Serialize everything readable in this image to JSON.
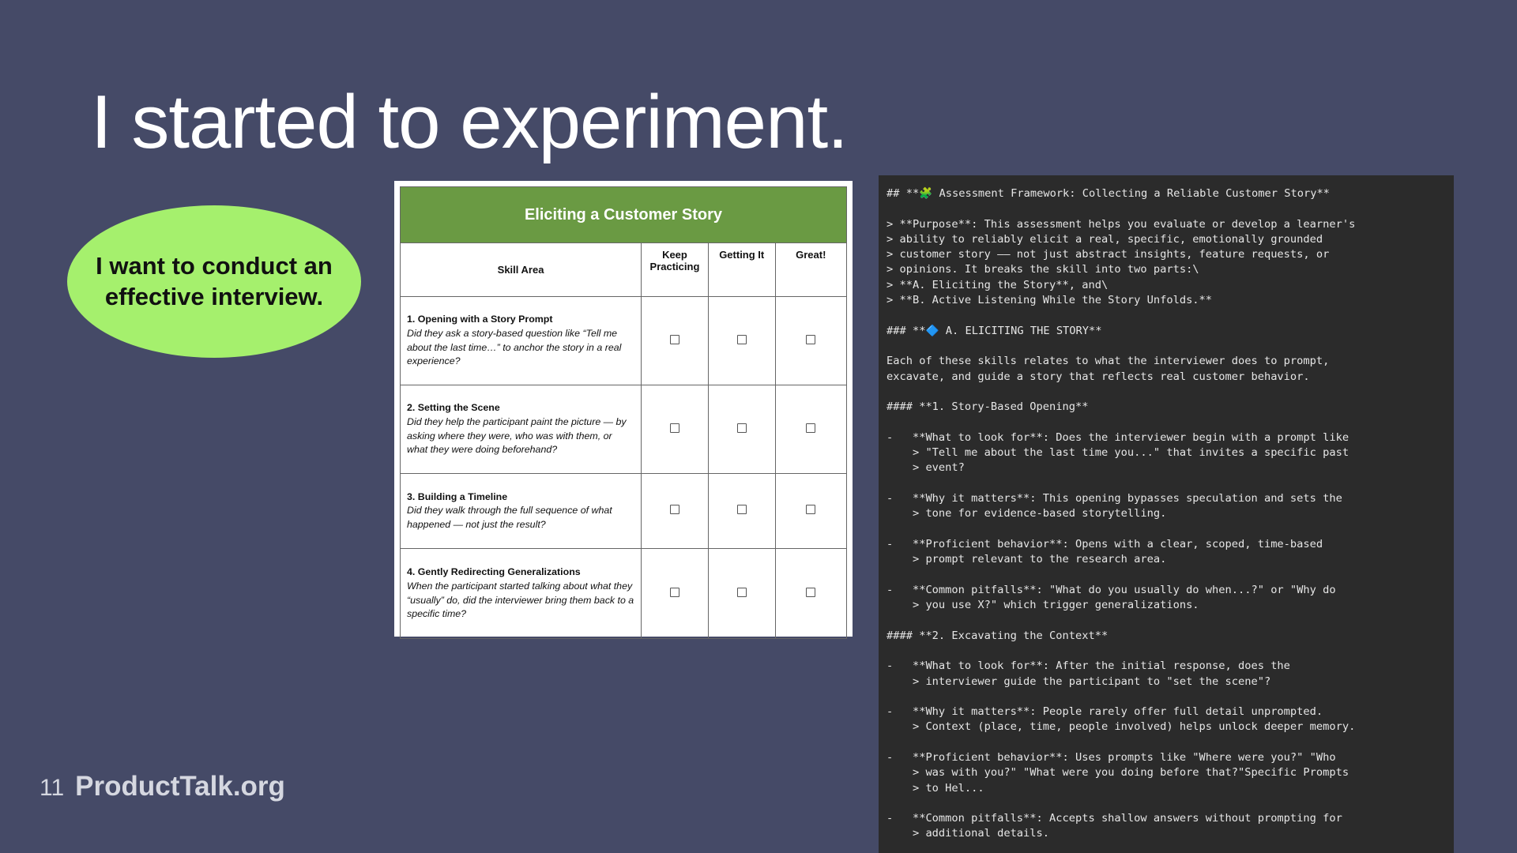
{
  "slide": {
    "title": "I started to experiment.",
    "goal_bubble": "I want to conduct an effective interview.",
    "page_number": "11",
    "brand": "ProductTalk.org"
  },
  "rubric": {
    "title": "Eliciting a Customer Story",
    "columns": {
      "skill_area": "Skill Area",
      "keep_practicing": "Keep Practicing",
      "getting_it": "Getting It",
      "great": "Great!"
    },
    "rows": [
      {
        "name": "1. Opening with a Story Prompt",
        "desc": "Did they ask a story-based question like “Tell me about the last time…” to anchor the story in a real experience?"
      },
      {
        "name": "2. Setting the Scene",
        "desc": "Did they help the participant paint the picture — by asking where they were, who was with them, or what they were doing beforehand?"
      },
      {
        "name": "3. Building a Timeline",
        "desc": "Did they walk through the full sequence of what happened — not just the result?"
      },
      {
        "name": "4. Gently Redirecting Generalizations",
        "desc": "When the participant started talking about what they “usually” do, did the interviewer bring them back to a specific time?"
      }
    ]
  },
  "markdown_lines": [
    "## **🧩 Assessment Framework: Collecting a Reliable Customer Story**",
    "",
    "> **Purpose**: This assessment helps you evaluate or develop a learner's",
    "> ability to reliably elicit a real, specific, emotionally grounded",
    "> customer story —— not just abstract insights, feature requests, or",
    "> opinions. It breaks the skill into two parts:\\",
    "> **A. Eliciting the Story**, and\\",
    "> **B. Active Listening While the Story Unfolds.**",
    "",
    "### **🔷 A. ELICITING THE STORY**",
    "",
    "Each of these skills relates to what the interviewer does to prompt,",
    "excavate, and guide a story that reflects real customer behavior.",
    "",
    "#### **1. Story-Based Opening**",
    "",
    "-   **What to look for**: Does the interviewer begin with a prompt like",
    "    > \"Tell me about the last time you...\" that invites a specific past",
    "    > event?",
    "",
    "-   **Why it matters**: This opening bypasses speculation and sets the",
    "    > tone for evidence-based storytelling.",
    "",
    "-   **Proficient behavior**: Opens with a clear, scoped, time-based",
    "    > prompt relevant to the research area.",
    "",
    "-   **Common pitfalls**: \"What do you usually do when...?\" or \"Why do",
    "    > you use X?\" which trigger generalizations.",
    "",
    "#### **2. Excavating the Context**",
    "",
    "-   **What to look for**: After the initial response, does the",
    "    > interviewer guide the participant to \"set the scene\"?",
    "",
    "-   **Why it matters**: People rarely offer full detail unprompted.",
    "    > Context (place, time, people involved) helps unlock deeper memory.",
    "",
    "-   **Proficient behavior**: Uses prompts like \"Where were you?\" \"Who",
    "    > was with you?\" \"What were you doing before that?\"Specific Prompts",
    "    > to Hel...",
    "",
    "-   **Common pitfalls**: Accepts shallow answers without prompting for",
    "    > additional details."
  ]
}
